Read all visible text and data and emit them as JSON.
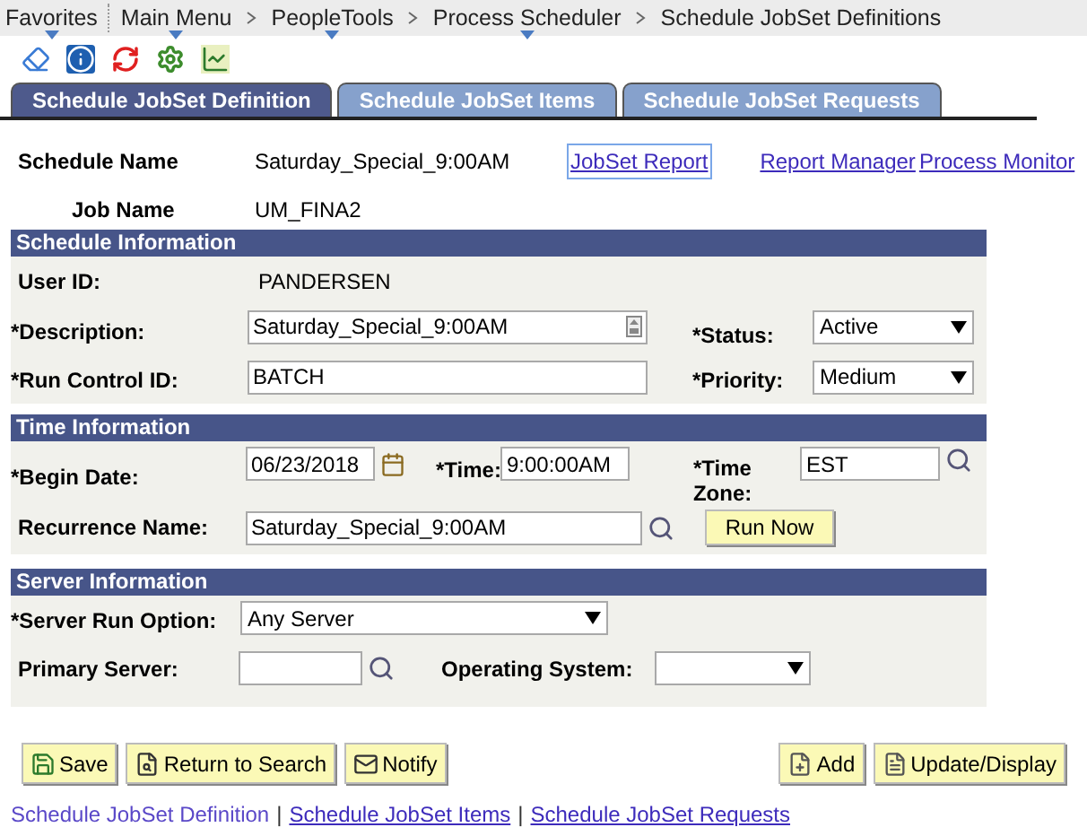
{
  "breadcrumb": [
    {
      "label": "Favorites",
      "menu": true
    },
    {
      "label": "Main Menu",
      "menu": true
    },
    {
      "label": "PeopleTools",
      "menu": true
    },
    {
      "label": "Process Scheduler",
      "menu": true
    },
    {
      "label": "Schedule JobSet Definitions",
      "menu": false
    }
  ],
  "tabs": [
    {
      "label": "Schedule JobSet Definition",
      "selected": true
    },
    {
      "label": "Schedule JobSet Items",
      "selected": false
    },
    {
      "label": "Schedule JobSet Requests",
      "selected": false
    }
  ],
  "schedule_name": {
    "label": "Schedule Name",
    "value": "Saturday_Special_9:00AM"
  },
  "header_links": [
    {
      "label": "JobSet Report",
      "focused": true
    },
    {
      "label": "Report Manager",
      "focused": false
    },
    {
      "label": "Process Monitor",
      "focused": false
    }
  ],
  "job_name": {
    "label": "Job Name",
    "value": "UM_FINA2"
  },
  "schedule_information": {
    "title": "Schedule Information",
    "user_id": {
      "label": "User ID:",
      "value": "PANDERSEN"
    },
    "description": {
      "label": "*Description:",
      "value": "Saturday_Special_9:00AM"
    },
    "status": {
      "label": "*Status:",
      "value": "Active"
    },
    "run_control_id": {
      "label": "*Run Control ID:",
      "value": "BATCH"
    },
    "priority": {
      "label": "*Priority:",
      "value": "Medium"
    }
  },
  "time_information": {
    "title": "Time Information",
    "begin_date": {
      "label": "*Begin Date:",
      "value": "06/23/2018"
    },
    "time": {
      "label": "*Time:",
      "value": "9:00:00AM"
    },
    "time_zone": {
      "label": "*Time Zone:",
      "value": "EST"
    },
    "recurrence_name": {
      "label": "Recurrence Name:",
      "value": "Saturday_Special_9:00AM"
    },
    "run_now": "Run Now"
  },
  "server_information": {
    "title": "Server Information",
    "server_run_option": {
      "label": "*Server Run Option:",
      "value": "Any Server"
    },
    "primary_server": {
      "label": "Primary Server:"
    },
    "operating_system": {
      "label": "Operating System:"
    }
  },
  "buttons_left": [
    {
      "label": "Save",
      "kind": "save"
    },
    {
      "label": "Return to Search",
      "kind": "search"
    },
    {
      "label": "Notify",
      "kind": "notify"
    }
  ],
  "buttons_right": [
    {
      "label": "Add",
      "kind": "add"
    },
    {
      "label": "Update/Display",
      "kind": "update"
    }
  ],
  "footer_links": [
    {
      "label": "Schedule JobSet Definition",
      "selected": true
    },
    {
      "label": "Schedule JobSet Items",
      "selected": false
    },
    {
      "label": "Schedule JobSet Requests",
      "selected": false
    }
  ],
  "footer_separator": "|"
}
